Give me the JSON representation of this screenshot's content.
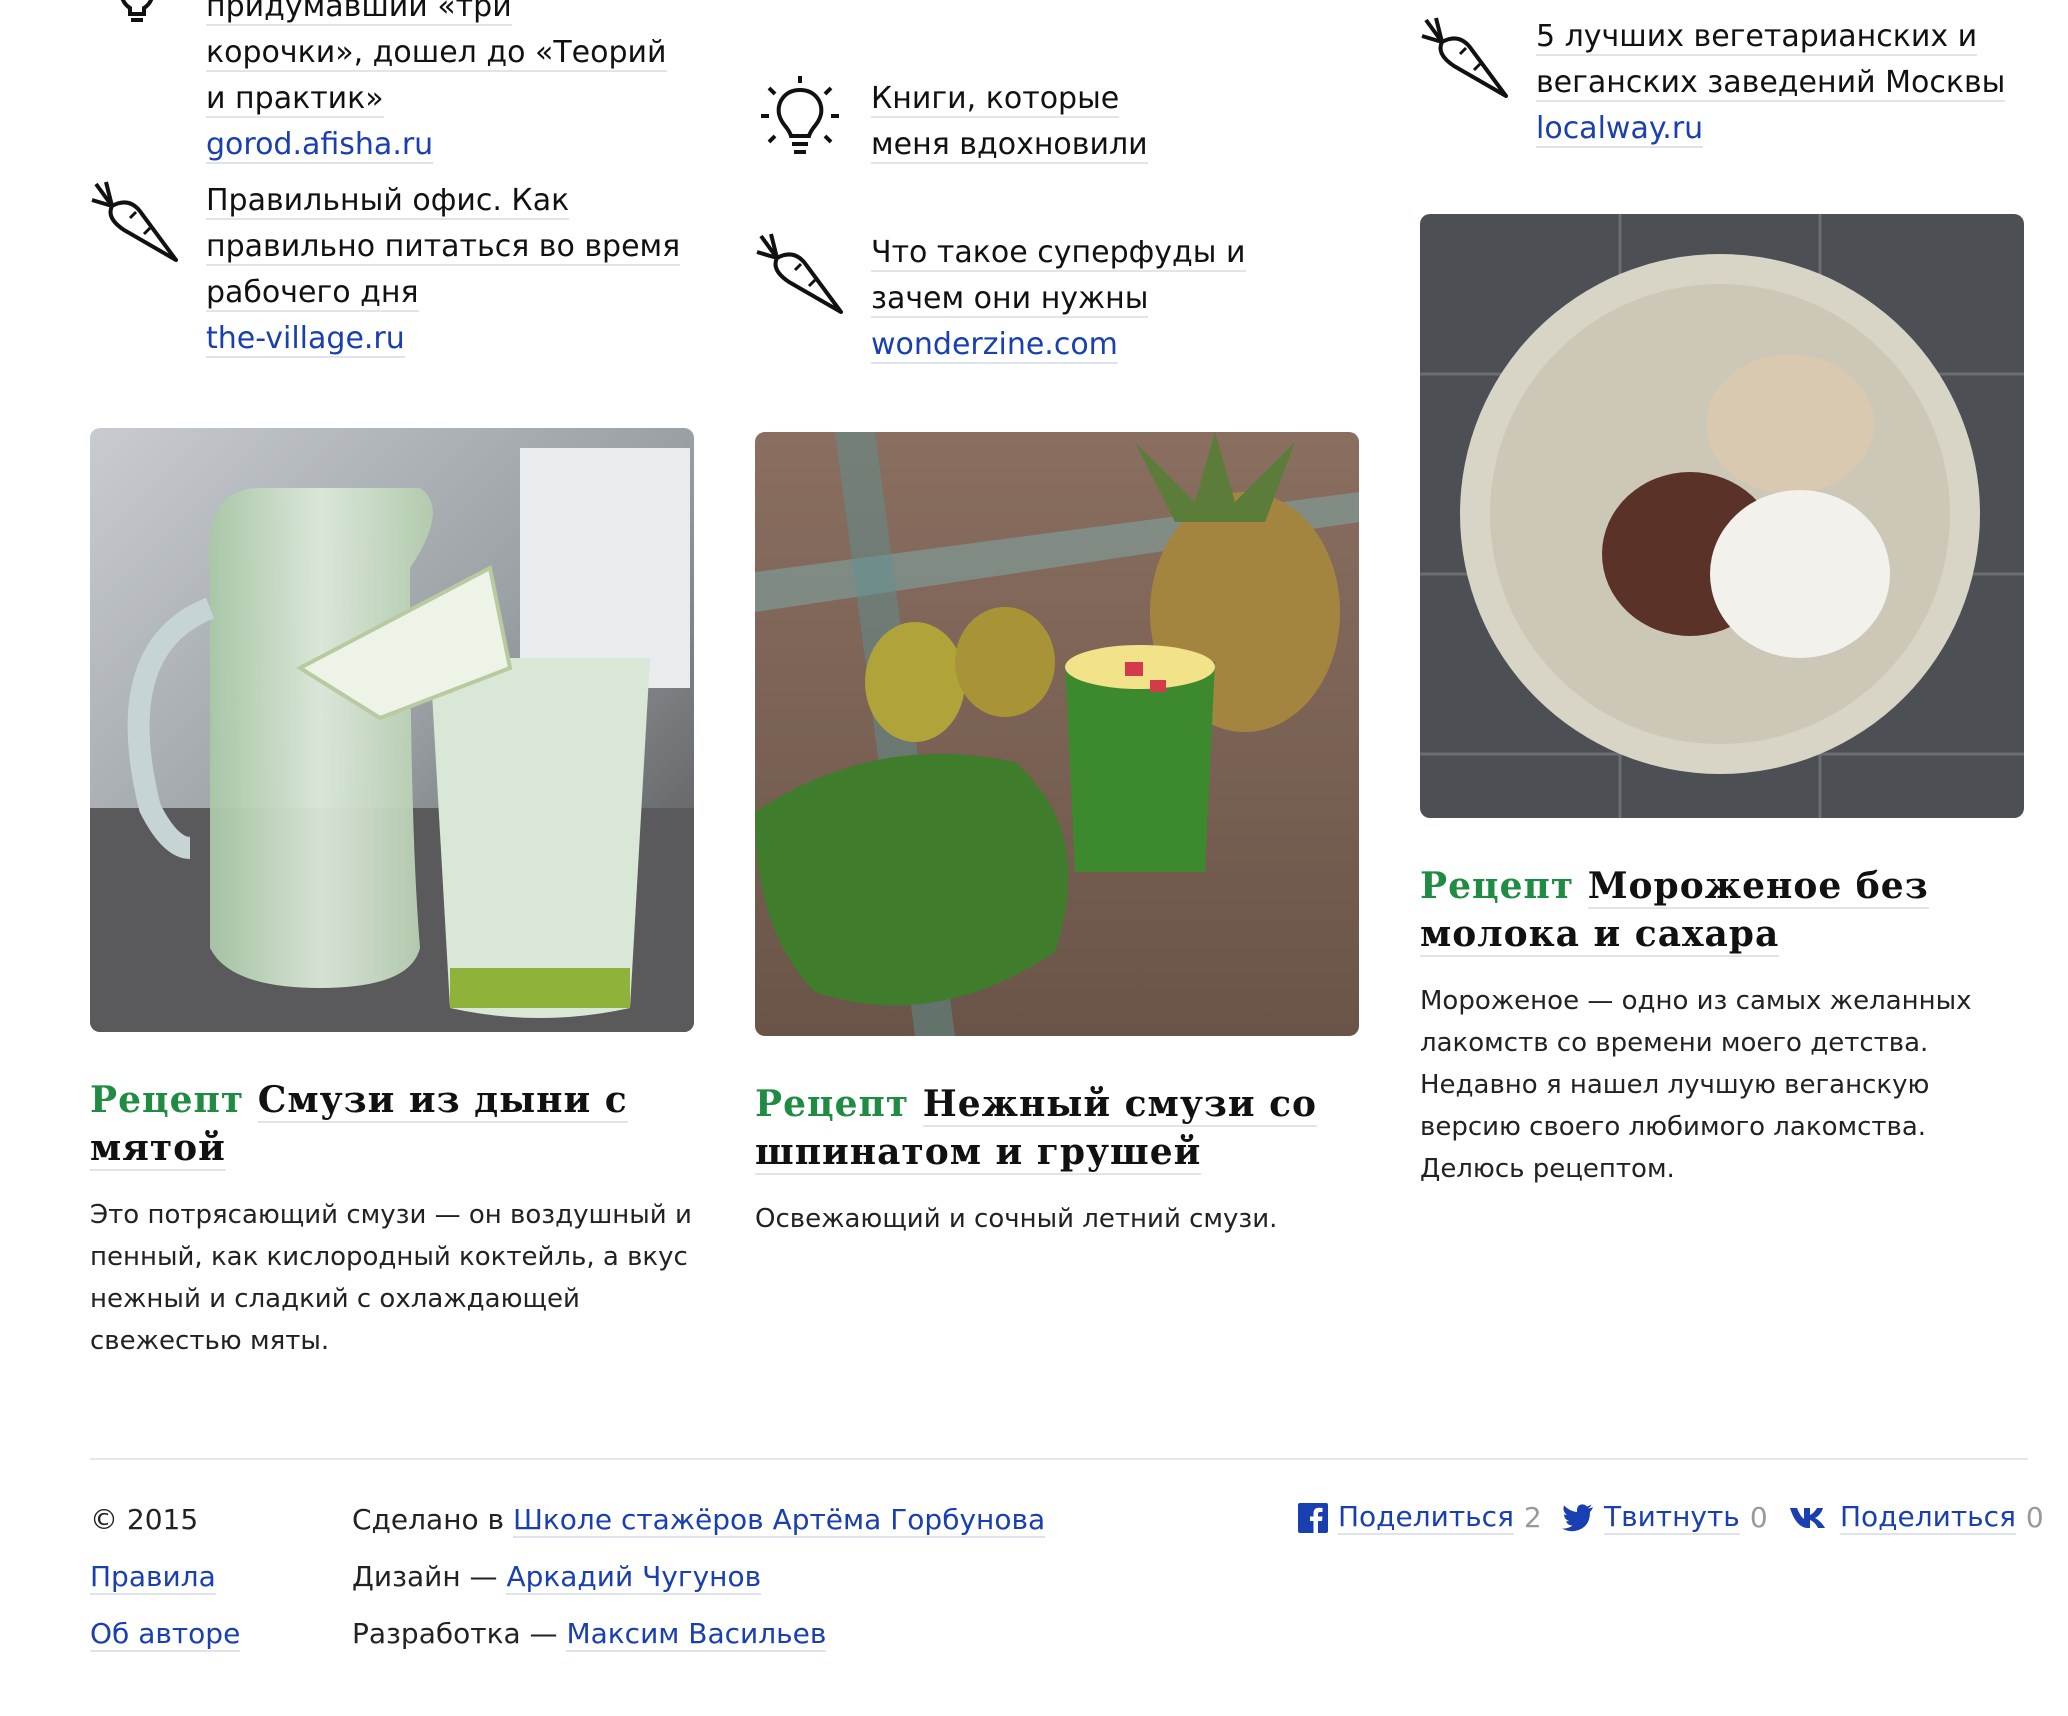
{
  "links": [
    {
      "icon": "lightbulb-icon",
      "title": "придумавший «три корочки», дошел до «Теорий и практик»",
      "url": "gorod.afisha.ru"
    },
    {
      "icon": "carrot-icon",
      "title": "Правильный офис. Как правильно питаться во время рабочего дня",
      "url": "the-village.ru"
    },
    {
      "icon": "lightbulb-icon",
      "title": "Книги, которые меня вдохновили",
      "url": ""
    },
    {
      "icon": "carrot-icon",
      "title": "Что такое суперфуды и зачем они нужны",
      "url": "wonderzine.com"
    },
    {
      "icon": "carrot-icon",
      "title": "5 лучших вегетарианских и веганских заведений Москвы",
      "url": "localway.ru"
    }
  ],
  "cards": [
    {
      "kind": "Рецепт",
      "name": "Смузи из дыни с мятой",
      "desc": "Это потрясающий смузи — он воздушный и пенный, как кислородный коктейль, а вкус нежный и сладкий с охлаждающей свежестью мяты."
    },
    {
      "kind": "Рецепт",
      "name": "Нежный смузи со шпинатом и грушей",
      "desc": "Освежающий и сочный летний смузи."
    },
    {
      "kind": "Рецепт",
      "name": "Мороженое без молока и сахара",
      "desc": "Мороженое — одно из самых желанных лакомств со времени моего детства. Недавно я нашел лучшую веганскую версию своего любимого лакомства. Делюсь рецептом."
    }
  ],
  "footer": {
    "copyright": "© 2015",
    "rules": "Правила",
    "about": "Об авторе",
    "made_prefix": "Сделано в ",
    "made_link": "Школе стажёров Артёма Горбунова",
    "design_prefix": "Дизайн — ",
    "design_link": "Аркадий Чугунов",
    "dev_prefix": "Разработка — ",
    "dev_link": "Максим Васильев"
  },
  "share": [
    {
      "network": "facebook-icon",
      "label": "Поделиться",
      "count": "2"
    },
    {
      "network": "twitter-icon",
      "label": "Твитнуть",
      "count": "0"
    },
    {
      "network": "vk-icon",
      "label": "Поделиться",
      "count": "0"
    }
  ],
  "colors": {
    "accent": "#1f8b43",
    "link": "#1a3fb0"
  }
}
